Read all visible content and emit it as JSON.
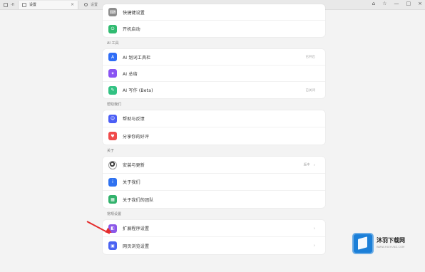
{
  "browser": {
    "tabs": [
      {
        "label": "-fi"
      },
      {
        "label": "设置"
      }
    ],
    "address_text": "设置"
  },
  "sections": {
    "top": [
      {
        "label": "快捷键设置",
        "right": "",
        "icon": "keyboard-icon",
        "color": "#8d8d8d"
      },
      {
        "label": "开机启动",
        "right": "",
        "icon": "power-icon",
        "color": "#31bb71"
      }
    ],
    "ai": {
      "title": "AI 工具",
      "items": [
        {
          "label": "AI 划词工具栏",
          "right": "已开启",
          "icon": "ai-toolbar-icon",
          "color": "#2f6df6"
        },
        {
          "label": "AI 总结",
          "right": "",
          "icon": "ai-summary-icon",
          "color": "#8a54f3"
        },
        {
          "label": "AI 写作 (Beta)",
          "right": "已关闭",
          "icon": "ai-write-icon",
          "color": "#32c283"
        }
      ]
    },
    "help": {
      "title": "帮助我们",
      "items": [
        {
          "label": "帮助与反馈",
          "right": "",
          "icon": "feedback-icon",
          "color": "#4b5ef5"
        },
        {
          "label": "分享你的好评",
          "right": "",
          "icon": "heart-icon",
          "color": "#f04b4b"
        }
      ]
    },
    "about": {
      "title": "关于",
      "items": [
        {
          "label": "安装与更新",
          "right": "版本",
          "icon": "profile-avatar",
          "color": "#444444"
        },
        {
          "label": "关于我们",
          "right": "",
          "icon": "info-icon",
          "color": "#2f72f0"
        },
        {
          "label": "关于我们的团队",
          "right": "",
          "icon": "team-icon",
          "color": "#32b26c"
        }
      ]
    },
    "general": {
      "title": "常规设置",
      "items": [
        {
          "label": "扩展程序设置",
          "right": "",
          "icon": "extension-icon",
          "color": "#8b57e8"
        },
        {
          "label": "网页浏览设置",
          "right": "",
          "icon": "web-icon",
          "color": "#4b63f2"
        }
      ]
    }
  },
  "watermark": {
    "brand": "沐羽下载网",
    "url": "WWW.HUIYUNZ.COM"
  }
}
